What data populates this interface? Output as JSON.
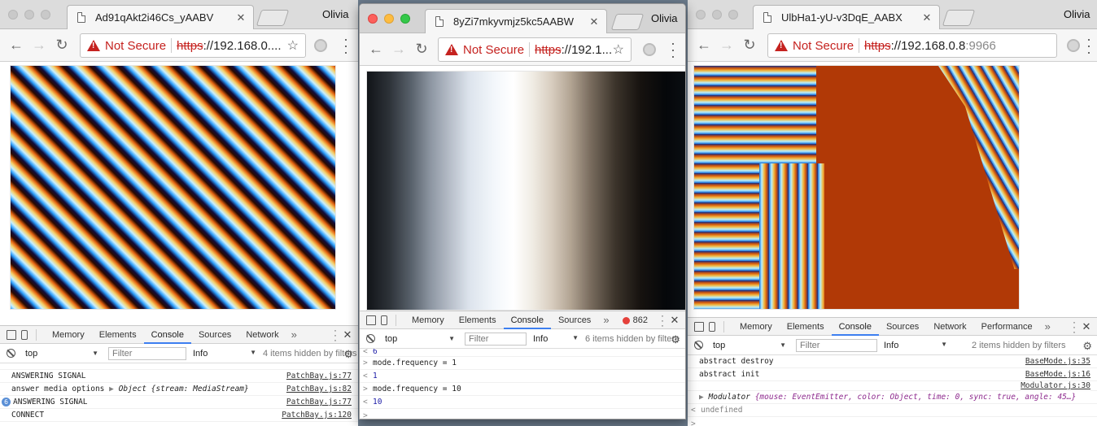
{
  "colors": {
    "warning_red": "#c5221f",
    "active_tab_underline": "#3d7ff0",
    "mac_red": "#fc605c",
    "mac_yellow": "#fdbc40",
    "mac_green": "#34c84a"
  },
  "windows": [
    {
      "tab_title": "Ad91qAkt2i46Cs_yAABV",
      "profile": "Olivia",
      "omnibox": {
        "security": "Not Secure",
        "scheme": "https",
        "host": "://192.168.0....",
        "port": ""
      },
      "canvas": "diagonal-stripes",
      "devtools": {
        "tabs": [
          "Memory",
          "Elements",
          "Console",
          "Sources",
          "Network"
        ],
        "active_tab": "Console",
        "more": "»",
        "context": "top",
        "filter_placeholder": "Filter",
        "level": "Info",
        "hidden_note": "4 items hidden by filters",
        "rows": [
          {
            "msg": "ANSWERING SIGNAL",
            "src": "PatchBay.js:77"
          },
          {
            "msg": "answer media options",
            "extra": "Object {stream: MediaStream}",
            "src": "PatchBay.js:82"
          },
          {
            "badge": "6",
            "msg": "ANSWERING SIGNAL",
            "src": "PatchBay.js:77"
          },
          {
            "msg": "CONNECT",
            "src": "PatchBay.js:120"
          }
        ]
      }
    },
    {
      "tab_title": "8yZi7mkyvmjz5kc5AABW",
      "profile": "Olivia",
      "omnibox": {
        "security": "Not Secure",
        "scheme": "https",
        "host": "://192.1...",
        "port": ""
      },
      "canvas": "grayscale-gradient",
      "devtools": {
        "tabs": [
          "Memory",
          "Elements",
          "Console",
          "Sources"
        ],
        "active_tab": "Console",
        "more": "»",
        "error_count": "862",
        "context": "top",
        "filter_placeholder": "Filter",
        "level": "Info",
        "hidden_note": "6 items hidden by filters",
        "rows": [
          {
            "pre": "<",
            "msg": "6",
            "kind": "result"
          },
          {
            "pre": ">",
            "msg": "mode.frequency = 1",
            "kind": "input"
          },
          {
            "pre": "<",
            "msg": "1",
            "kind": "result"
          },
          {
            "pre": ">",
            "msg": "mode.frequency = 10",
            "kind": "input"
          },
          {
            "pre": "<",
            "msg": "10",
            "kind": "result"
          }
        ],
        "prompt": ">"
      }
    },
    {
      "tab_title": "UlbHa1-yU-v3DqE_AABX",
      "profile": "Olivia",
      "omnibox": {
        "security": "Not Secure",
        "scheme": "https",
        "host": "://192.168.0.8",
        "port": ":9966"
      },
      "canvas": "modulator-pattern",
      "devtools": {
        "tabs": [
          "Memory",
          "Elements",
          "Console",
          "Sources",
          "Network",
          "Performance"
        ],
        "active_tab": "Console",
        "more": "»",
        "context": "top",
        "filter_placeholder": "Filter",
        "level": "Info",
        "hidden_note": "2 items hidden by filters",
        "rows": [
          {
            "msg": "abstract destroy",
            "src": "BaseMode.js:35"
          },
          {
            "msg": "abstract init",
            "src": "BaseMode.js:16"
          },
          {
            "msg": "",
            "src": "Modulator.js:30"
          },
          {
            "msg": "Modulator",
            "extra": "{mouse: EventEmitter, color: Object, time: 0, sync: true, angle: 45…}"
          },
          {
            "pre": "<",
            "msg": "undefined",
            "kind": "result"
          }
        ],
        "prompt": ">"
      }
    }
  ]
}
